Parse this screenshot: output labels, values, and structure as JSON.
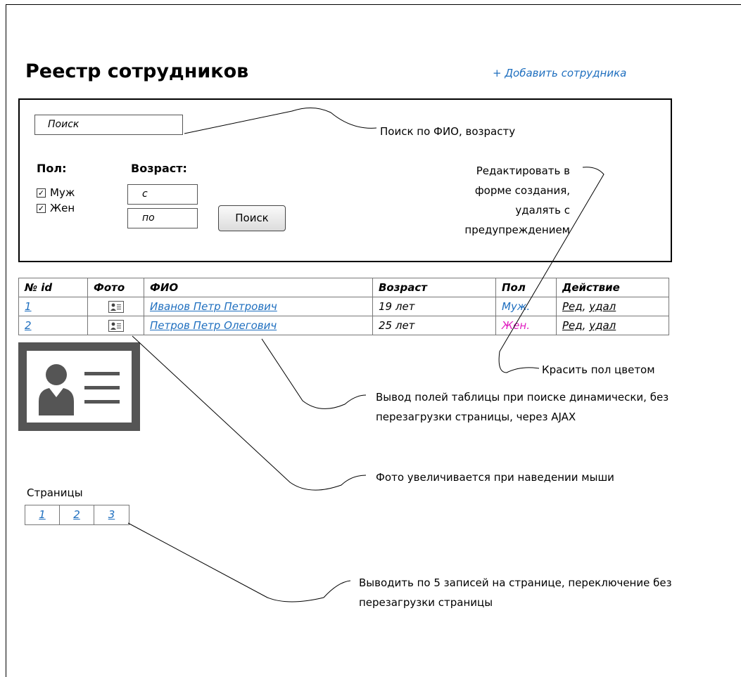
{
  "page": {
    "title": "Реестр сотрудников",
    "add_link": "+ Добавить сотрудника"
  },
  "filter": {
    "search_placeholder": "Поиск",
    "gender_label": "Пол:",
    "gender_options": [
      "Муж",
      "Жен"
    ],
    "gender_checked": [
      true,
      true
    ],
    "age_label": "Возраст:",
    "age_from": "с",
    "age_to": "по",
    "search_button": "Поиск"
  },
  "annotations": {
    "search": "Поиск по ФИО, возрасту",
    "edit": [
      "Редактировать в",
      "форме создания,",
      "удалять с",
      "предупреждением"
    ],
    "gender_color": "Красить пол цветом",
    "ajax": [
      "Вывод полей таблицы при поиске динамически, без",
      "перезагрузки страницы, через AJAX"
    ],
    "photo": "Фото увеличивается при наведении мыши",
    "paging": [
      "Выводить по 5 записей на странице, переключение без",
      "перезагрузки страницы"
    ]
  },
  "table": {
    "headers": [
      "№ id",
      "Фото",
      "ФИО",
      "Возраст",
      "Пол",
      "Действие"
    ],
    "rows": [
      {
        "id": "1",
        "name": "Иванов Петр Петрович",
        "age": "19 лет",
        "gender": "Муж.",
        "gender_color": "#1f6fbf",
        "edit": "Ред",
        "sep": ",",
        "delete": "удал"
      },
      {
        "id": "2",
        "name": "Петров Петр Олегович",
        "age": "25 лет",
        "gender": "Жен.",
        "gender_color": "#e020c0",
        "edit": "Ред",
        "sep": ",",
        "delete": "удал"
      }
    ]
  },
  "pager": {
    "label": "Страницы",
    "pages": [
      "1",
      "2",
      "3"
    ]
  },
  "colors": {
    "link": "#1f6fbf",
    "female": "#e020c0"
  }
}
